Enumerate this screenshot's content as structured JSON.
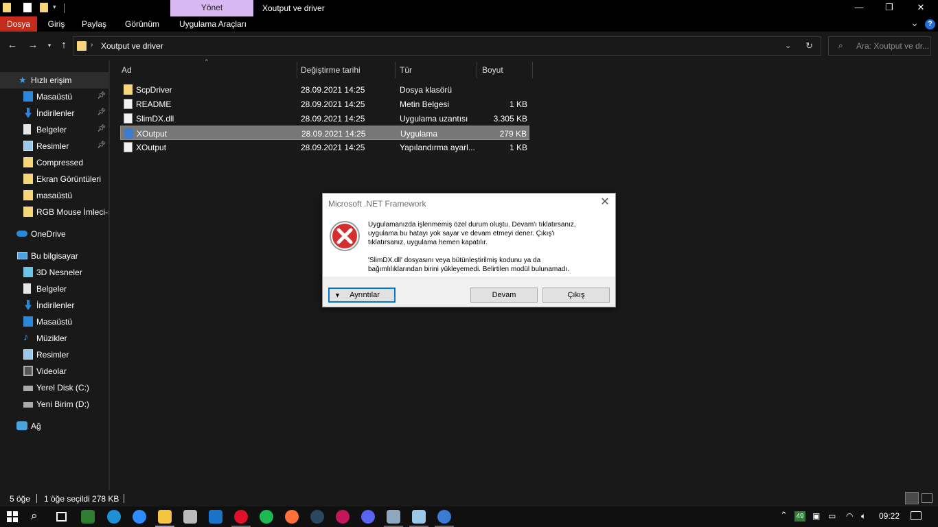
{
  "titlebar": {
    "manage_tab": "Yönet",
    "window_title": "Xoutput ve driver",
    "minimize": "—",
    "maximize": "❐",
    "close": "✕"
  },
  "ribbon": {
    "tabs": [
      "Dosya",
      "Giriş",
      "Paylaş",
      "Görünüm",
      "Uygulama Araçları"
    ],
    "collapse": "⌄",
    "help": "?"
  },
  "address": {
    "path": "Xoutput ve driver",
    "search_placeholder": "Ara: Xoutput ve dr..."
  },
  "sidebar": {
    "quick_access": "Hızlı erişim",
    "quick_items": [
      {
        "label": "Masaüstü",
        "icon": "desktop-icon",
        "pinned": true
      },
      {
        "label": "İndirilenler",
        "icon": "download-icon",
        "pinned": true
      },
      {
        "label": "Belgeler",
        "icon": "documents-icon",
        "pinned": true
      },
      {
        "label": "Resimler",
        "icon": "pictures-icon",
        "pinned": true
      },
      {
        "label": "Compressed",
        "icon": "folder-icon",
        "pinned": false
      },
      {
        "label": "Ekran Görüntüleri",
        "icon": "folder-icon",
        "pinned": false
      },
      {
        "label": "masaüstü",
        "icon": "folder-icon",
        "pinned": false
      },
      {
        "label": "RGB Mouse İmleci-s",
        "icon": "folder-icon",
        "pinned": false
      }
    ],
    "onedrive": "OneDrive",
    "this_pc": "Bu bilgisayar",
    "pc_items": [
      {
        "label": "3D Nesneler",
        "icon": "3d-objects-icon"
      },
      {
        "label": "Belgeler",
        "icon": "documents-icon"
      },
      {
        "label": "İndirilenler",
        "icon": "download-icon"
      },
      {
        "label": "Masaüstü",
        "icon": "desktop-icon"
      },
      {
        "label": "Müzikler",
        "icon": "music-icon"
      },
      {
        "label": "Resimler",
        "icon": "pictures-icon"
      },
      {
        "label": "Videolar",
        "icon": "videos-icon"
      },
      {
        "label": "Yerel Disk (C:)",
        "icon": "drive-c-icon"
      },
      {
        "label": "Yeni Birim (D:)",
        "icon": "drive-d-icon"
      }
    ],
    "network": "Ağ"
  },
  "columns": {
    "name": "Ad",
    "date": "Değiştirme tarihi",
    "type": "Tür",
    "size": "Boyut"
  },
  "files": [
    {
      "name": "ScpDriver",
      "date": "28.09.2021 14:25",
      "type": "Dosya klasörü",
      "size": "",
      "icon": "folder-icon"
    },
    {
      "name": "README",
      "date": "28.09.2021 14:25",
      "type": "Metin Belgesi",
      "size": "1 KB",
      "icon": "text-file-icon"
    },
    {
      "name": "SlimDX.dll",
      "date": "28.09.2021 14:25",
      "type": "Uygulama uzantısı",
      "size": "3.305 KB",
      "icon": "dll-file-icon"
    },
    {
      "name": "XOutput",
      "date": "28.09.2021 14:25",
      "type": "Uygulama",
      "size": "279 KB",
      "icon": "app-icon"
    },
    {
      "name": "XOutput",
      "date": "28.09.2021 14:25",
      "type": "Yapılandırma ayarl...",
      "size": "1 KB",
      "icon": "config-file-icon"
    }
  ],
  "dialog": {
    "title": "Microsoft .NET Framework",
    "message_line1": "Uygulamanızda işlenmemiş özel durum oluştu. Devam'ı tıklatırsanız,",
    "message_line2": "uygulama bu hatayı yok sayar ve devam etmeyi dener. Çıkış'ı",
    "message_line3": "tıklatırsanız, uygulama hemen kapatılır.",
    "message_line4": "'SlimDX.dll' dosyasını veya bütünleştirilmiş kodunu ya da",
    "message_line5": "bağımlılıklarından birini yükleyemedi. Belirtilen modül bulunamadı.",
    "details_button": "Ayrıntılar",
    "continue_button": "Devam",
    "quit_button": "Çıkış"
  },
  "status": {
    "count": "5 öğe",
    "selected": "1 öğe seçildi  278 KB"
  },
  "taskbar": {
    "badge": "49",
    "time": "09:22"
  },
  "colors": {
    "file_tab": "#c42b1c",
    "manage_tab": "#d9b7f2",
    "selection": "#777777",
    "error_red": "#d32f2f"
  }
}
